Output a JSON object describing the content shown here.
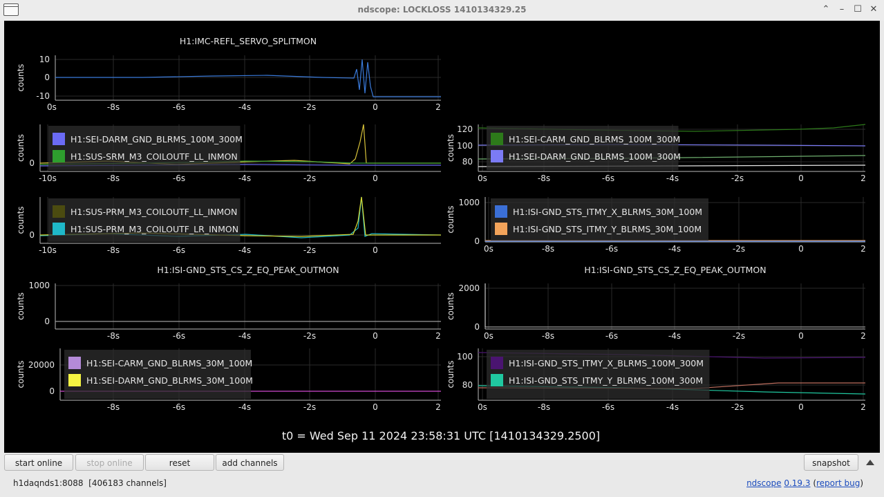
{
  "window": {
    "title": "ndscope: LOCKLOSS 1410134329.25"
  },
  "plots": [
    {
      "title": "H1:IMC-REFL_SERVO_SPLITMON",
      "ylabel": "counts",
      "yticks": [
        "10",
        "0",
        "-10"
      ],
      "xticks": [
        "0s",
        "-8s",
        "-6s",
        "-4s",
        "-2s",
        "0",
        "2"
      ],
      "legend": []
    },
    {
      "title": "",
      "ylabel": "counts",
      "yticks": [
        "0"
      ],
      "xticks": [
        "-10s",
        "-8s",
        "-6s",
        "-4s",
        "-2s",
        "0"
      ],
      "legend": [
        {
          "name": "H1:SEI-DARM_GND_BLRMS_100M_300M",
          "color": "#6b6bf5"
        },
        {
          "name": "H1:SUS-SRM_M3_COILOUTF_LL_INMON",
          "color": "#2e9e2e"
        }
      ]
    },
    {
      "title": "",
      "ylabel": "counts",
      "yticks": [
        "120",
        "100",
        "80"
      ],
      "xticks": [
        "0s",
        "-8s",
        "-6s",
        "-4s",
        "-2s",
        "0",
        "2"
      ],
      "legend": [
        {
          "name": "H1:SEI-CARM_GND_BLRMS_100M_300M",
          "color": "#2d7a1a"
        },
        {
          "name": "H1:SEI-DARM_GND_BLRMS_100M_300M",
          "color": "#7b7bf5"
        }
      ]
    },
    {
      "title": "",
      "ylabel": "counts",
      "yticks": [
        "0"
      ],
      "xticks": [
        "-10s",
        "-8s",
        "-6s",
        "-4s",
        "-2s",
        "0"
      ],
      "legend": [
        {
          "name": "H1:SUS-PRM_M3_COILOUTF_LL_INMON",
          "color": "#4b4b10"
        },
        {
          "name": "H1:SUS-PRM_M3_COILOUTF_LR_INMON",
          "color": "#1fb8c8"
        }
      ]
    },
    {
      "title": "",
      "ylabel": "counts",
      "yticks": [
        "1000",
        "0"
      ],
      "xticks": [
        "0s",
        "-8s",
        "-6s",
        "-4s",
        "-2s",
        "0",
        "2"
      ],
      "legend": [
        {
          "name": "H1:ISI-GND_STS_ITMY_X_BLRMS_30M_100M",
          "color": "#3b6fd6"
        },
        {
          "name": "H1:ISI-GND_STS_ITMY_Y_BLRMS_30M_100M",
          "color": "#f2a35a"
        }
      ]
    },
    {
      "title": "H1:ISI-GND_STS_CS_Z_EQ_PEAK_OUTMON",
      "ylabel": "counts",
      "yticks": [
        "1000",
        "0"
      ],
      "xticks": [
        "-8s",
        "-6s",
        "-4s",
        "-2s",
        "0",
        "2"
      ],
      "legend": []
    },
    {
      "title": "H1:ISI-GND_STS_CS_Z_EQ_PEAK_OUTMON",
      "ylabel": "counts",
      "yticks": [
        "2000",
        "0"
      ],
      "xticks": [
        "0s",
        "-8s",
        "-6s",
        "-4s",
        "-2s",
        "0",
        "2"
      ],
      "legend": []
    },
    {
      "title": "",
      "ylabel": "counts",
      "yticks": [
        "20000",
        "0"
      ],
      "xticks": [
        "-8s",
        "-6s",
        "-4s",
        "-2s",
        "0",
        "2"
      ],
      "legend": [
        {
          "name": "H1:SEI-CARM_GND_BLRMS_30M_100M",
          "color": "#b48ad8"
        },
        {
          "name": "H1:SEI-DARM_GND_BLRMS_30M_100M",
          "color": "#f5f542"
        }
      ]
    },
    {
      "title": "",
      "ylabel": "counts",
      "yticks": [
        "100",
        "80"
      ],
      "xticks": [
        "0s",
        "-8s",
        "-6s",
        "-4s",
        "-2s",
        "0",
        "2"
      ],
      "legend": [
        {
          "name": "H1:ISI-GND_STS_ITMY_X_BLRMS_100M_300M",
          "color": "#4a1470"
        },
        {
          "name": "H1:ISI-GND_STS_ITMY_Y_BLRMS_100M_300M",
          "color": "#20c8a0"
        }
      ]
    }
  ],
  "t0_label": "t0 = Wed Sep 11 2024 23:58:31 UTC [1410134329.2500]",
  "toolbar": {
    "start_online": "start online",
    "stop_online": "stop online",
    "reset": "reset",
    "add_channels": "add channels",
    "snapshot": "snapshot"
  },
  "status": {
    "server": "h1daqnds1:8088  [406183 channels]",
    "app": "ndscope",
    "version": "0.19.3",
    "report": "report bug"
  }
}
